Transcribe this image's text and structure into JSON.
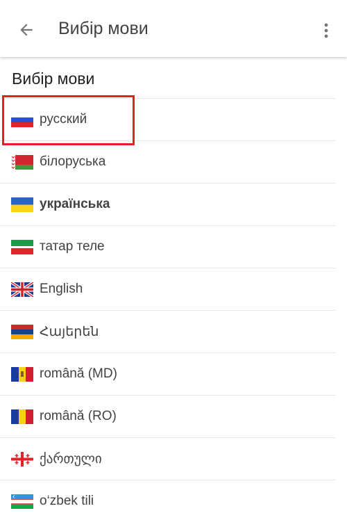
{
  "appbar": {
    "title": "Вибір мови",
    "back_icon": "arrow-back-icon",
    "menu_icon": "more-vert-icon"
  },
  "section": {
    "title": "Вибір мови"
  },
  "languages": [
    {
      "label": "русский",
      "flag": "flag-ru",
      "selected": false
    },
    {
      "label": "білоруська",
      "flag": "flag-by",
      "selected": false
    },
    {
      "label": "українська",
      "flag": "flag-ua",
      "selected": true
    },
    {
      "label": "татар теле",
      "flag": "flag-tatar",
      "selected": false
    },
    {
      "label": "English",
      "flag": "flag-uk",
      "selected": false
    },
    {
      "label": "Հայերեն",
      "flag": "flag-am",
      "selected": false
    },
    {
      "label": "română (MD)",
      "flag": "flag-md",
      "selected": false
    },
    {
      "label": "română (RO)",
      "flag": "flag-ro",
      "selected": false
    },
    {
      "label": "ქართული",
      "flag": "flag-ge",
      "selected": false
    },
    {
      "label": "o‘zbek tili",
      "flag": "flag-uz",
      "selected": false
    }
  ],
  "colors": {
    "highlight": "#e32026",
    "text": "#424242",
    "divider": "#e6e6e6"
  }
}
